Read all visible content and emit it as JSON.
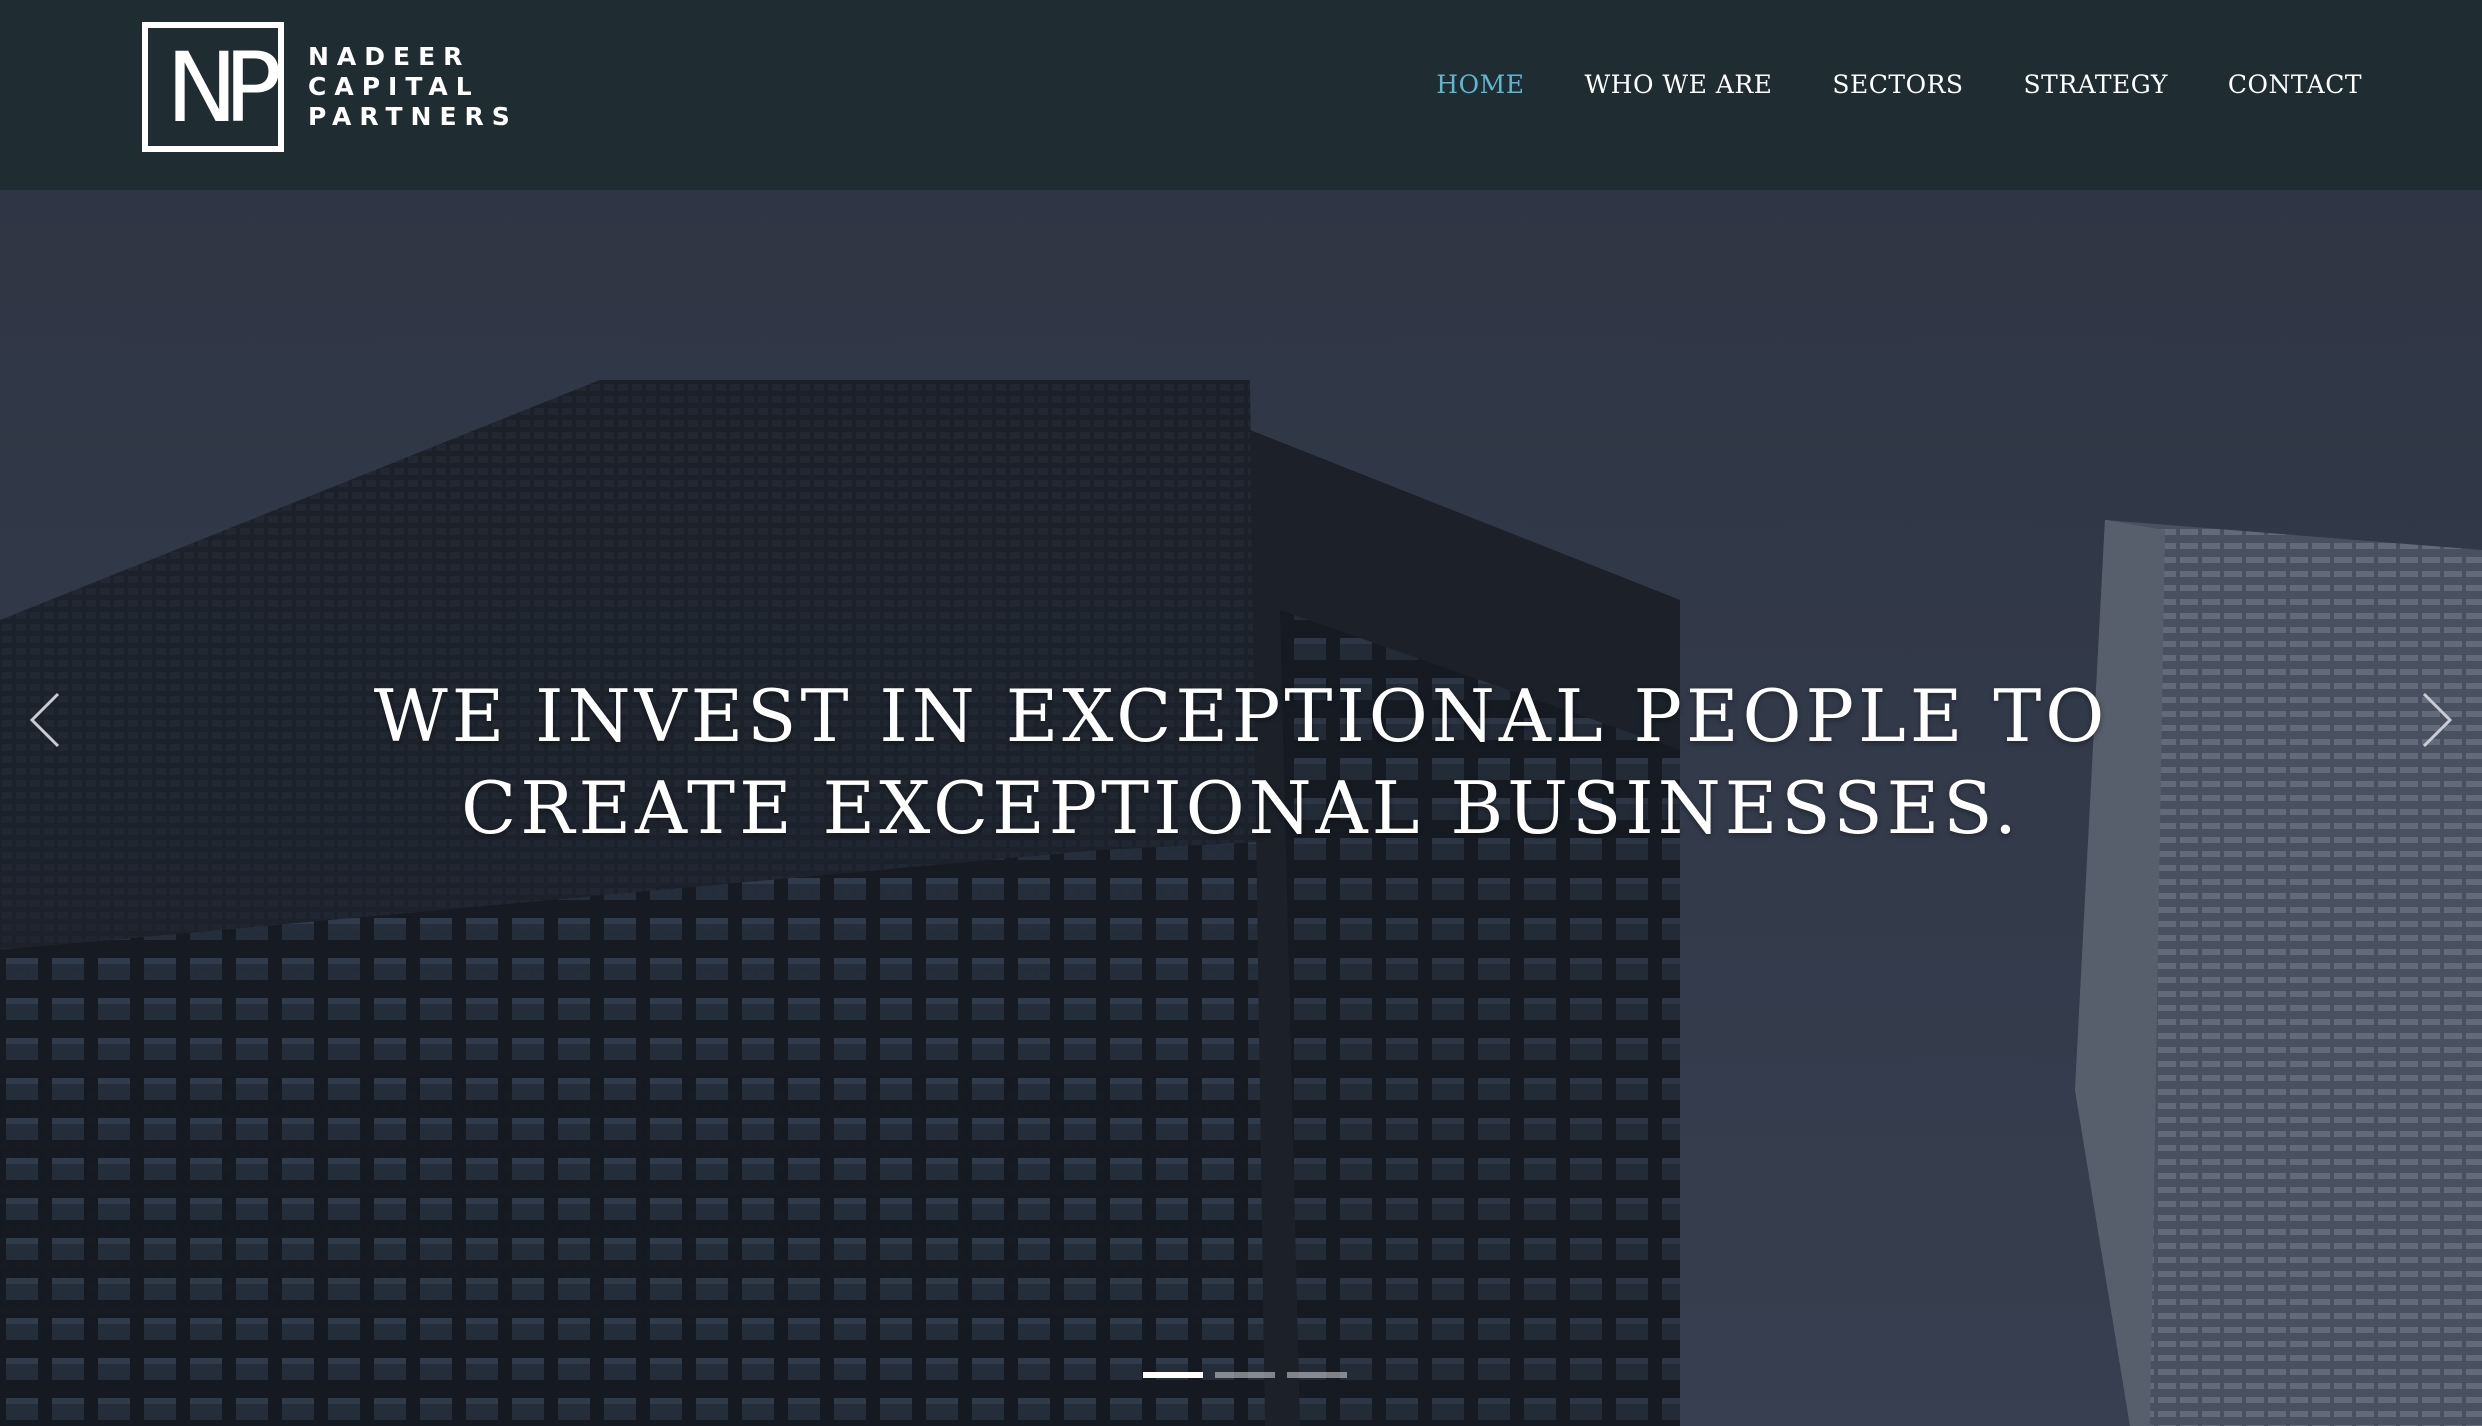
{
  "brand": {
    "monogram": "NP",
    "name_lines": [
      "NADEER",
      "CAPITAL",
      "PARTNERS"
    ]
  },
  "nav": {
    "items": [
      {
        "label": "HOME",
        "active": true
      },
      {
        "label": "WHO WE ARE",
        "active": false
      },
      {
        "label": "SECTORS",
        "active": false
      },
      {
        "label": "STRATEGY",
        "active": false
      },
      {
        "label": "CONTACT",
        "active": false
      }
    ]
  },
  "hero": {
    "headline_lines": [
      "WE INVEST IN EXCEPTIONAL PEOPLE TO",
      "CREATE EXCEPTIONAL BUSINESSES."
    ],
    "slides": 3,
    "active_slide": 1
  },
  "colors": {
    "header_bg": "#1f2d32",
    "nav_active": "#5fb6d1",
    "text": "#ffffff"
  }
}
